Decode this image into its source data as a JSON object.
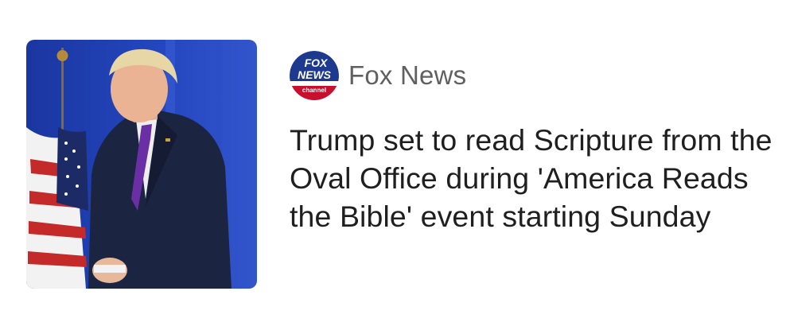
{
  "article": {
    "source_name": "Fox News",
    "logo": {
      "line1": "FOX",
      "line2": "NEWS",
      "line3": "channel"
    },
    "headline": "Trump set to read Scripture from the Oval Office during 'America Reads the Bible' event starting Sunday",
    "thumbnail_icon": "person-photo"
  },
  "colors": {
    "headline": "#1f1f1f",
    "source": "#606060",
    "photo_background": "#1f3fa8",
    "logo_blue": "#1d3a8f",
    "logo_red": "#c8102e"
  }
}
